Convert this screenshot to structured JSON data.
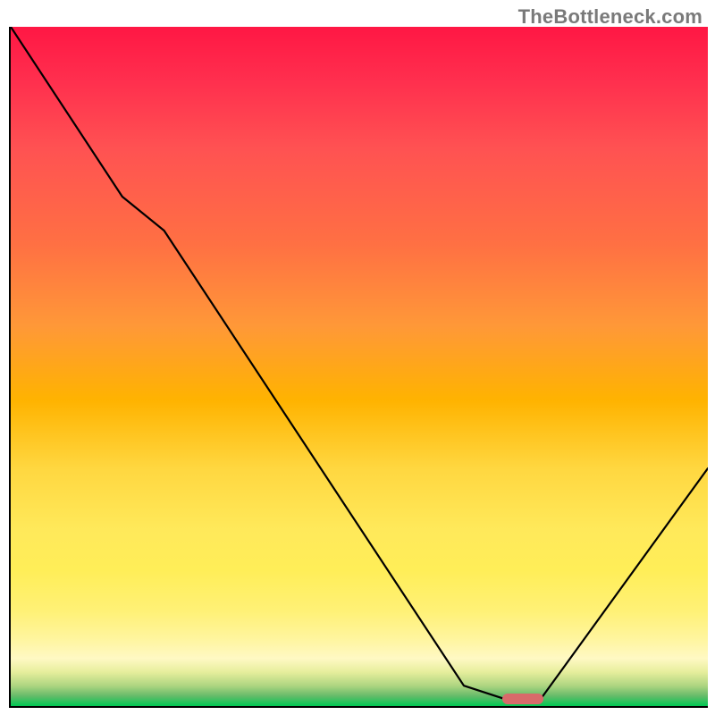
{
  "watermark": "TheBottleneck.com",
  "chart_data": {
    "type": "line",
    "title": "",
    "xlabel": "",
    "ylabel": "",
    "xlim": [
      0,
      100
    ],
    "ylim": [
      0,
      100
    ],
    "grid": false,
    "series": [
      {
        "name": "bottleneck-curve",
        "color": "#000000",
        "x": [
          0,
          16,
          22,
          65,
          71,
          76,
          100
        ],
        "values": [
          100,
          75,
          70,
          3,
          1,
          1,
          35
        ]
      }
    ],
    "marker": {
      "name": "optimal-point",
      "x_center": 73.5,
      "y": 1,
      "width_pct": 5.9,
      "color": "#d86a6a"
    },
    "background_gradient": {
      "top": "#ff1744",
      "mid": "#ffd740",
      "bottom": "#00c853"
    }
  }
}
